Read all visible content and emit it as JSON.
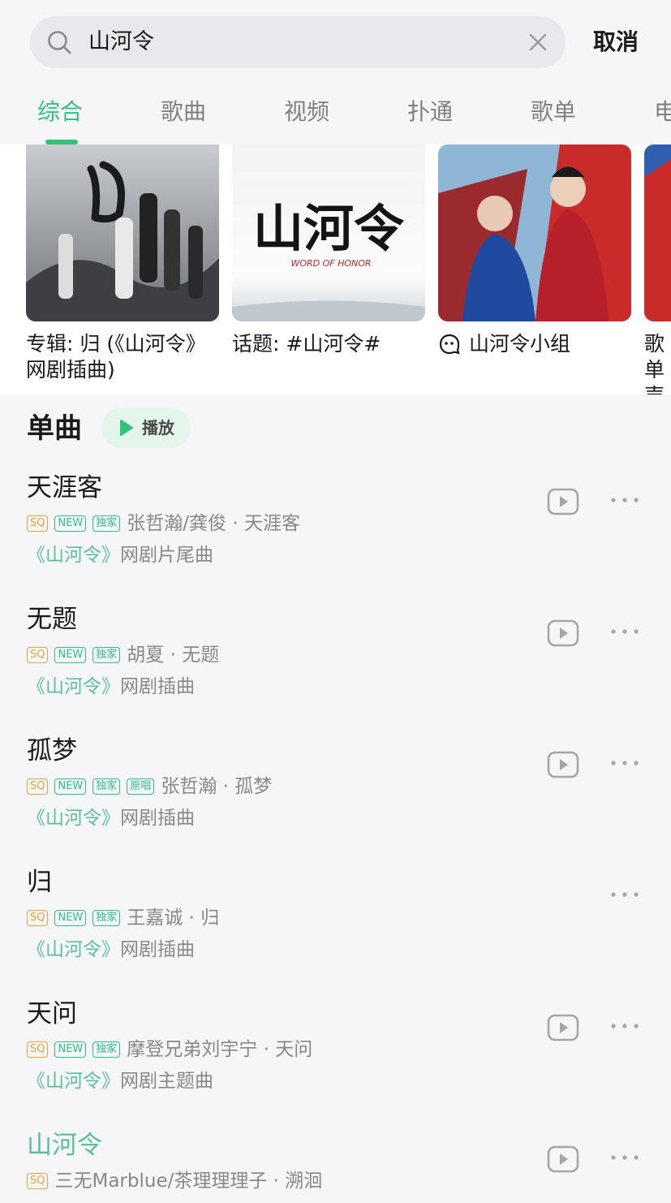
{
  "search": {
    "query": "山河令",
    "cancel": "取消"
  },
  "tabs": [
    "综合",
    "歌曲",
    "视频",
    "扑通",
    "歌单",
    "电"
  ],
  "cards": [
    {
      "label": "专辑: 归 (《山河令》网剧插曲)"
    },
    {
      "label": "话题: #山河令#",
      "logo_text": "山河令",
      "logo_sub": "WORD OF HONOR"
    },
    {
      "label": "山河令小组"
    },
    {
      "label": "歌单 声"
    }
  ],
  "section": {
    "title": "单曲",
    "play_all": "播放"
  },
  "songs": [
    {
      "title": "天涯客",
      "badges": [
        "SQ",
        "NEW",
        "独家"
      ],
      "artist": "张哲瀚/龚俊 · 天涯客",
      "sub_keyword": "《山河令》",
      "sub_rest": "网剧片尾曲",
      "has_mv": true
    },
    {
      "title": "无题",
      "badges": [
        "SQ",
        "NEW",
        "独家"
      ],
      "artist": "胡夏 · 无题",
      "sub_keyword": "《山河令》",
      "sub_rest": "网剧插曲",
      "has_mv": true
    },
    {
      "title": "孤梦",
      "badges": [
        "SQ",
        "NEW",
        "独家",
        "原唱"
      ],
      "artist": "张哲瀚 · 孤梦",
      "sub_keyword": "《山河令》",
      "sub_rest": "网剧插曲",
      "has_mv": true
    },
    {
      "title": "归",
      "badges": [
        "SQ",
        "NEW",
        "独家"
      ],
      "artist": "王嘉诚 · 归",
      "sub_keyword": "《山河令》",
      "sub_rest": "网剧插曲",
      "has_mv": false
    },
    {
      "title": "天问",
      "badges": [
        "SQ",
        "NEW",
        "独家"
      ],
      "artist": "摩登兄弟刘宇宁 · 天问",
      "sub_keyword": "《山河令》",
      "sub_rest": "网剧主题曲",
      "has_mv": true
    },
    {
      "title": "山河令",
      "badges": [
        "SQ"
      ],
      "artist": "三无Marblue/茶理理理子 · 溯洄",
      "sub_keyword": "",
      "sub_rest": "",
      "has_mv": true,
      "title_highlight": true
    }
  ],
  "colors": {
    "accent": "#31c27c",
    "sq": "#e2a53d",
    "muted": "#888888"
  },
  "icons": {
    "search": "search-icon",
    "clear": "close-icon",
    "mv": "play-video-icon",
    "more": "more-icon",
    "group": "group-chat-icon"
  }
}
